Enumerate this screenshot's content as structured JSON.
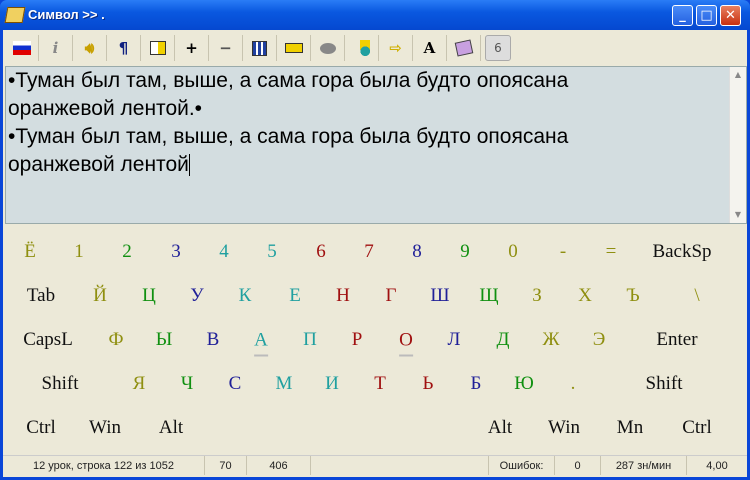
{
  "window": {
    "title": "Символ >> ."
  },
  "toolbar": {
    "flag": "russian-flag",
    "info": "i",
    "pilcrow": "¶",
    "font": "A",
    "level": "6",
    "plus": "+",
    "minus": "−",
    "arrow": "⇨"
  },
  "text": {
    "line1": "•Туман был там, выше, а сама гора была будто опоясана",
    "line2": "оранжевой лентой.•",
    "line3": "•Туман был там, выше, а сама гора была будто опоясана",
    "line4": "оранжевой лентой"
  },
  "keyboard": {
    "rows": [
      [
        {
          "l": "Ё",
          "c": "olive"
        },
        {
          "l": "1",
          "c": "olive"
        },
        {
          "l": "2",
          "c": "green"
        },
        {
          "l": "3",
          "c": "navy"
        },
        {
          "l": "4",
          "c": "teal"
        },
        {
          "l": "5",
          "c": "teal"
        },
        {
          "l": "6",
          "c": "red"
        },
        {
          "l": "7",
          "c": "red"
        },
        {
          "l": "8",
          "c": "navy"
        },
        {
          "l": "9",
          "c": "green"
        },
        {
          "l": "0",
          "c": "olive"
        },
        {
          "l": "-",
          "c": "olive"
        },
        {
          "l": "=",
          "c": "olive"
        },
        {
          "l": "BackSp",
          "c": "black"
        }
      ],
      [
        {
          "l": "Tab",
          "c": "black"
        },
        {
          "l": "Й",
          "c": "olive"
        },
        {
          "l": "Ц",
          "c": "green"
        },
        {
          "l": "У",
          "c": "navy"
        },
        {
          "l": "К",
          "c": "teal"
        },
        {
          "l": "Е",
          "c": "teal"
        },
        {
          "l": "Н",
          "c": "red"
        },
        {
          "l": "Г",
          "c": "red"
        },
        {
          "l": "Ш",
          "c": "navy"
        },
        {
          "l": "Щ",
          "c": "green"
        },
        {
          "l": "З",
          "c": "olive"
        },
        {
          "l": "Х",
          "c": "olive"
        },
        {
          "l": "Ъ",
          "c": "olive"
        },
        {
          "l": "\\",
          "c": "olive"
        }
      ],
      [
        {
          "l": "CapsL",
          "c": "black"
        },
        {
          "l": "Ф",
          "c": "olive"
        },
        {
          "l": "Ы",
          "c": "green"
        },
        {
          "l": "В",
          "c": "navy"
        },
        {
          "l": "А",
          "c": "teal",
          "home": true
        },
        {
          "l": "П",
          "c": "teal"
        },
        {
          "l": "Р",
          "c": "red"
        },
        {
          "l": "О",
          "c": "red",
          "home": true
        },
        {
          "l": "Л",
          "c": "navy"
        },
        {
          "l": "Д",
          "c": "green"
        },
        {
          "l": "Ж",
          "c": "olive"
        },
        {
          "l": "Э",
          "c": "olive"
        },
        {
          "l": "Enter",
          "c": "black"
        }
      ],
      [
        {
          "l": "Shift",
          "c": "black"
        },
        {
          "l": "Я",
          "c": "olive"
        },
        {
          "l": "Ч",
          "c": "green"
        },
        {
          "l": "С",
          "c": "navy"
        },
        {
          "l": "М",
          "c": "teal"
        },
        {
          "l": "И",
          "c": "teal"
        },
        {
          "l": "Т",
          "c": "red"
        },
        {
          "l": "Ь",
          "c": "red"
        },
        {
          "l": "Б",
          "c": "navy"
        },
        {
          "l": "Ю",
          "c": "green"
        },
        {
          "l": ".",
          "c": "olive"
        },
        {
          "l": "Shift",
          "c": "black"
        }
      ],
      [
        {
          "l": "Ctrl",
          "c": "black"
        },
        {
          "l": "Win",
          "c": "black"
        },
        {
          "l": "Alt",
          "c": "black"
        },
        {
          "l": "Alt",
          "c": "black"
        },
        {
          "l": "Win",
          "c": "black"
        },
        {
          "l": "Mn",
          "c": "black"
        },
        {
          "l": "Ctrl",
          "c": "black"
        }
      ]
    ]
  },
  "status": {
    "lesson": "12 урок, строка 122 из 1052",
    "chars": "70",
    "total": "406",
    "errors_label": "Ошибок:",
    "errors": "0",
    "speed": "287 зн/мин",
    "score": "4,00"
  }
}
